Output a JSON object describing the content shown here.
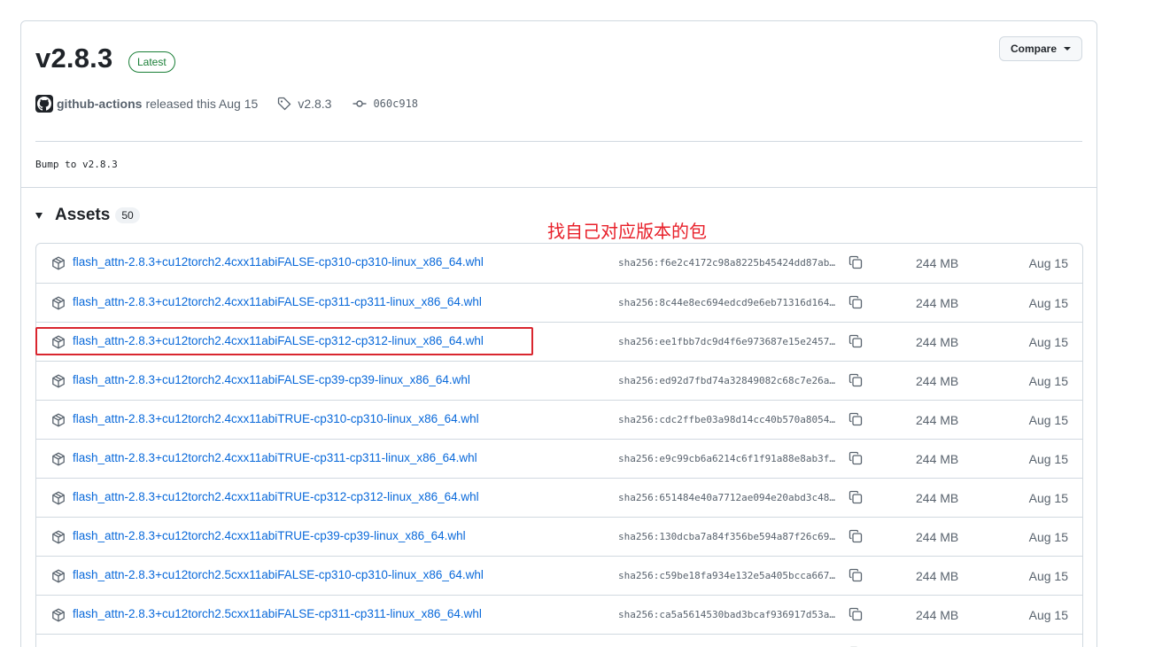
{
  "release": {
    "title": "v2.8.3",
    "badge": "Latest",
    "compare_label": "Compare",
    "author": "github-actions",
    "released_text": "released this Aug 15",
    "tag": "v2.8.3",
    "commit": "060c918",
    "notes": "Bump to v2.8.3"
  },
  "assets": {
    "title": "Assets",
    "count": "50",
    "annotation": "找自己对应版本的包",
    "items": [
      {
        "name": "flash_attn-2.8.3+cu12torch2.4cxx11abiFALSE-cp310-cp310-linux_x86_64.whl",
        "sha": "sha256:f6e2c4172c98a8225b45424dd87ab…",
        "size": "244 MB",
        "date": "Aug 15"
      },
      {
        "name": "flash_attn-2.8.3+cu12torch2.4cxx11abiFALSE-cp311-cp311-linux_x86_64.whl",
        "sha": "sha256:8c44e8ec694edcd9e6eb71316d164…",
        "size": "244 MB",
        "date": "Aug 15"
      },
      {
        "name": "flash_attn-2.8.3+cu12torch2.4cxx11abiFALSE-cp312-cp312-linux_x86_64.whl",
        "sha": "sha256:ee1fbb7dc9d4f6e973687e15e2457…",
        "size": "244 MB",
        "date": "Aug 15"
      },
      {
        "name": "flash_attn-2.8.3+cu12torch2.4cxx11abiFALSE-cp39-cp39-linux_x86_64.whl",
        "sha": "sha256:ed92d7fbd74a32849082c68c7e26a…",
        "size": "244 MB",
        "date": "Aug 15"
      },
      {
        "name": "flash_attn-2.8.3+cu12torch2.4cxx11abiTRUE-cp310-cp310-linux_x86_64.whl",
        "sha": "sha256:cdc2ffbe03a98d14cc40b570a8054…",
        "size": "244 MB",
        "date": "Aug 15"
      },
      {
        "name": "flash_attn-2.8.3+cu12torch2.4cxx11abiTRUE-cp311-cp311-linux_x86_64.whl",
        "sha": "sha256:e9c99cb6a6214c6f1f91a88e8ab3f…",
        "size": "244 MB",
        "date": "Aug 15"
      },
      {
        "name": "flash_attn-2.8.3+cu12torch2.4cxx11abiTRUE-cp312-cp312-linux_x86_64.whl",
        "sha": "sha256:651484e40a7712ae094e20abd3c48…",
        "size": "244 MB",
        "date": "Aug 15"
      },
      {
        "name": "flash_attn-2.8.3+cu12torch2.4cxx11abiTRUE-cp39-cp39-linux_x86_64.whl",
        "sha": "sha256:130dcba7a84f356be594a87f26c69…",
        "size": "244 MB",
        "date": "Aug 15"
      },
      {
        "name": "flash_attn-2.8.3+cu12torch2.5cxx11abiFALSE-cp310-cp310-linux_x86_64.whl",
        "sha": "sha256:c59be18fa934e132e5a405bcca667…",
        "size": "244 MB",
        "date": "Aug 15"
      },
      {
        "name": "flash_attn-2.8.3+cu12torch2.5cxx11abiFALSE-cp311-cp311-linux_x86_64.whl",
        "sha": "sha256:ca5a5614530bad3bcaf936917d53a…",
        "size": "244 MB",
        "date": "Aug 15"
      },
      {
        "name": "",
        "sha": "",
        "size": "",
        "date": ""
      }
    ]
  },
  "colors": {
    "link": "#0969da",
    "latest_green": "#1a7f37",
    "annotation_red": "#e8202a"
  }
}
